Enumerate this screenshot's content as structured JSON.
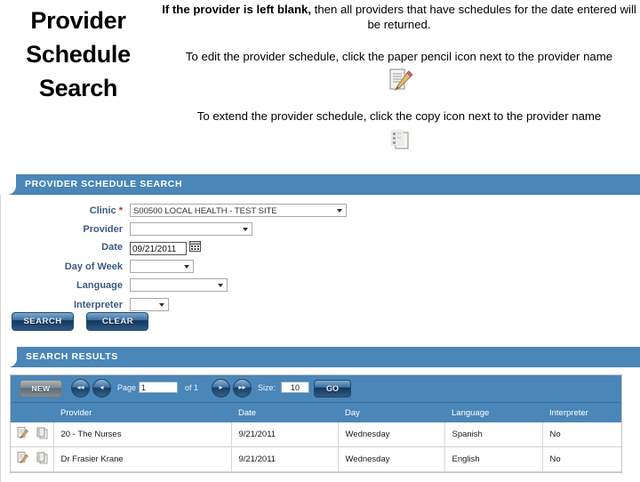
{
  "slide": {
    "title_lines": [
      "Provider",
      "Schedule",
      "Search"
    ],
    "notes": [
      {
        "bold": "If the provider is left blank,",
        "rest": " then all providers that have schedules for the date entered will be returned.",
        "icon": ""
      },
      {
        "bold": "",
        "rest": "To edit the provider schedule, click the paper pencil icon next to the provider name",
        "icon": "paper-pencil-icon"
      },
      {
        "bold": "",
        "rest": "To extend the provider schedule, click the copy icon next to the provider name",
        "icon": "copy-icon"
      }
    ]
  },
  "colors": {
    "header_blue": "#4a86b8",
    "label_blue": "#3d5a80",
    "required_red": "#c0392b",
    "button_blue": "#2d5a86"
  },
  "search_panel": {
    "header": "PROVIDER SCHEDULE SEARCH",
    "fields": [
      {
        "label": "Clinic",
        "required": "*",
        "control": "select",
        "value": "S00500   LOCAL HEALTH - TEST SITE"
      },
      {
        "label": "Provider",
        "required": "",
        "control": "select",
        "value": ""
      },
      {
        "label": "Date",
        "required": "",
        "control": "text",
        "value": "09/21/2011"
      },
      {
        "label": "Day of Week",
        "required": "",
        "control": "select",
        "value": ""
      },
      {
        "label": "Language",
        "required": "",
        "control": "select",
        "value": ""
      },
      {
        "label": "Interpreter",
        "required": "",
        "control": "select",
        "value": ""
      }
    ],
    "buttons": [
      {
        "label": "SEARCH"
      },
      {
        "label": "CLEAR"
      }
    ]
  },
  "results_panel": {
    "header": "SEARCH RESULTS",
    "pager": {
      "new_label": "NEW",
      "first_icon": "first-page-icon",
      "prev_icon": "previous-page-icon",
      "page_label": "Page",
      "page_value": "1",
      "of_label": "of 1",
      "next_icon": "next-page-icon",
      "last_icon": "last-page-icon",
      "size_label": "Size:",
      "size_value": "10",
      "go_label": "GO"
    },
    "columns": [
      "Provider",
      "Date",
      "Day",
      "Language",
      "Interpreter"
    ],
    "rows": [
      {
        "edit_icon": "paper-pencil-icon",
        "copy_icon": "copy-icon",
        "provider": "20 - The Nurses",
        "date": "9/21/2011",
        "day": "Wednesday",
        "language": "Spanish",
        "interpreter": "No"
      },
      {
        "edit_icon": "paper-pencil-icon",
        "copy_icon": "copy-icon",
        "provider": "Dr Frasier Krane",
        "date": "9/21/2011",
        "day": "Wednesday",
        "language": "English",
        "interpreter": "No"
      }
    ]
  }
}
